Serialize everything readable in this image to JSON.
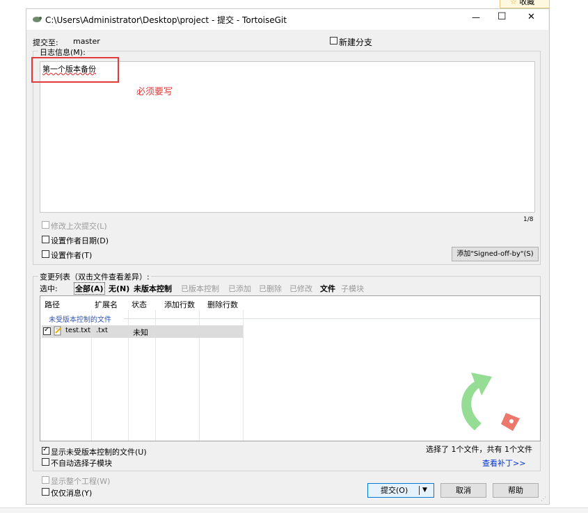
{
  "top_right_tag": "收藏",
  "window": {
    "title": "C:\\Users\\Administrator\\Desktop\\project - 提交 - TortoiseGit",
    "minimize": "—",
    "maximize": "☐",
    "close": "✕"
  },
  "commit_to": {
    "label": "提交至:",
    "value": "master"
  },
  "new_branch": {
    "label": "新建分支"
  },
  "log": {
    "label": "日志信息(M):",
    "message": "第一个版本备份",
    "annotation": "必须要写",
    "counter": "1/8"
  },
  "options": {
    "amend": "修改上次提交(L)",
    "set_date": "设置作者日期(D)",
    "set_author": "设置作者(T)",
    "signed_off": "添加\"Signed-off-by\"(S)"
  },
  "changes": {
    "label": "变更列表（双击文件查看差异）:",
    "select_label": "选中:",
    "filters": [
      {
        "label": "全部(A)",
        "state": "bold"
      },
      {
        "label": "无(N)",
        "state": "bold"
      },
      {
        "label": "未版本控制",
        "state": "bold"
      },
      {
        "label": "已版本控制",
        "state": "gray"
      },
      {
        "label": "已添加",
        "state": "gray"
      },
      {
        "label": "已删除",
        "state": "gray"
      },
      {
        "label": "已修改",
        "state": "gray"
      },
      {
        "label": "文件",
        "state": "bold"
      },
      {
        "label": "子模块",
        "state": "gray"
      }
    ],
    "columns": [
      "路径",
      "扩展名",
      "状态",
      "添加行数",
      "删除行数"
    ],
    "group_label": "未受版本控制的文件",
    "rows": [
      {
        "path": "test.txt",
        "ext": ".txt",
        "status": "未知",
        "added": "",
        "deleted": "",
        "checked": true
      }
    ]
  },
  "bottom": {
    "show_unversioned": "显示未受版本控制的文件(U)",
    "no_auto_submodule": "不自动选择子模块",
    "selection_summary": "选择了 1个文件，共有 1个文件",
    "view_patch": "查看补丁>>",
    "show_whole_project": "显示整个工程(W)",
    "message_only": "仅仅消息(Y)"
  },
  "buttons": {
    "commit": "提交(O)",
    "cancel": "取消",
    "help": "帮助"
  },
  "colors": {
    "annotation_red": "#e03a3a",
    "link_blue": "#0033cc",
    "group_blue": "#3355aa"
  }
}
